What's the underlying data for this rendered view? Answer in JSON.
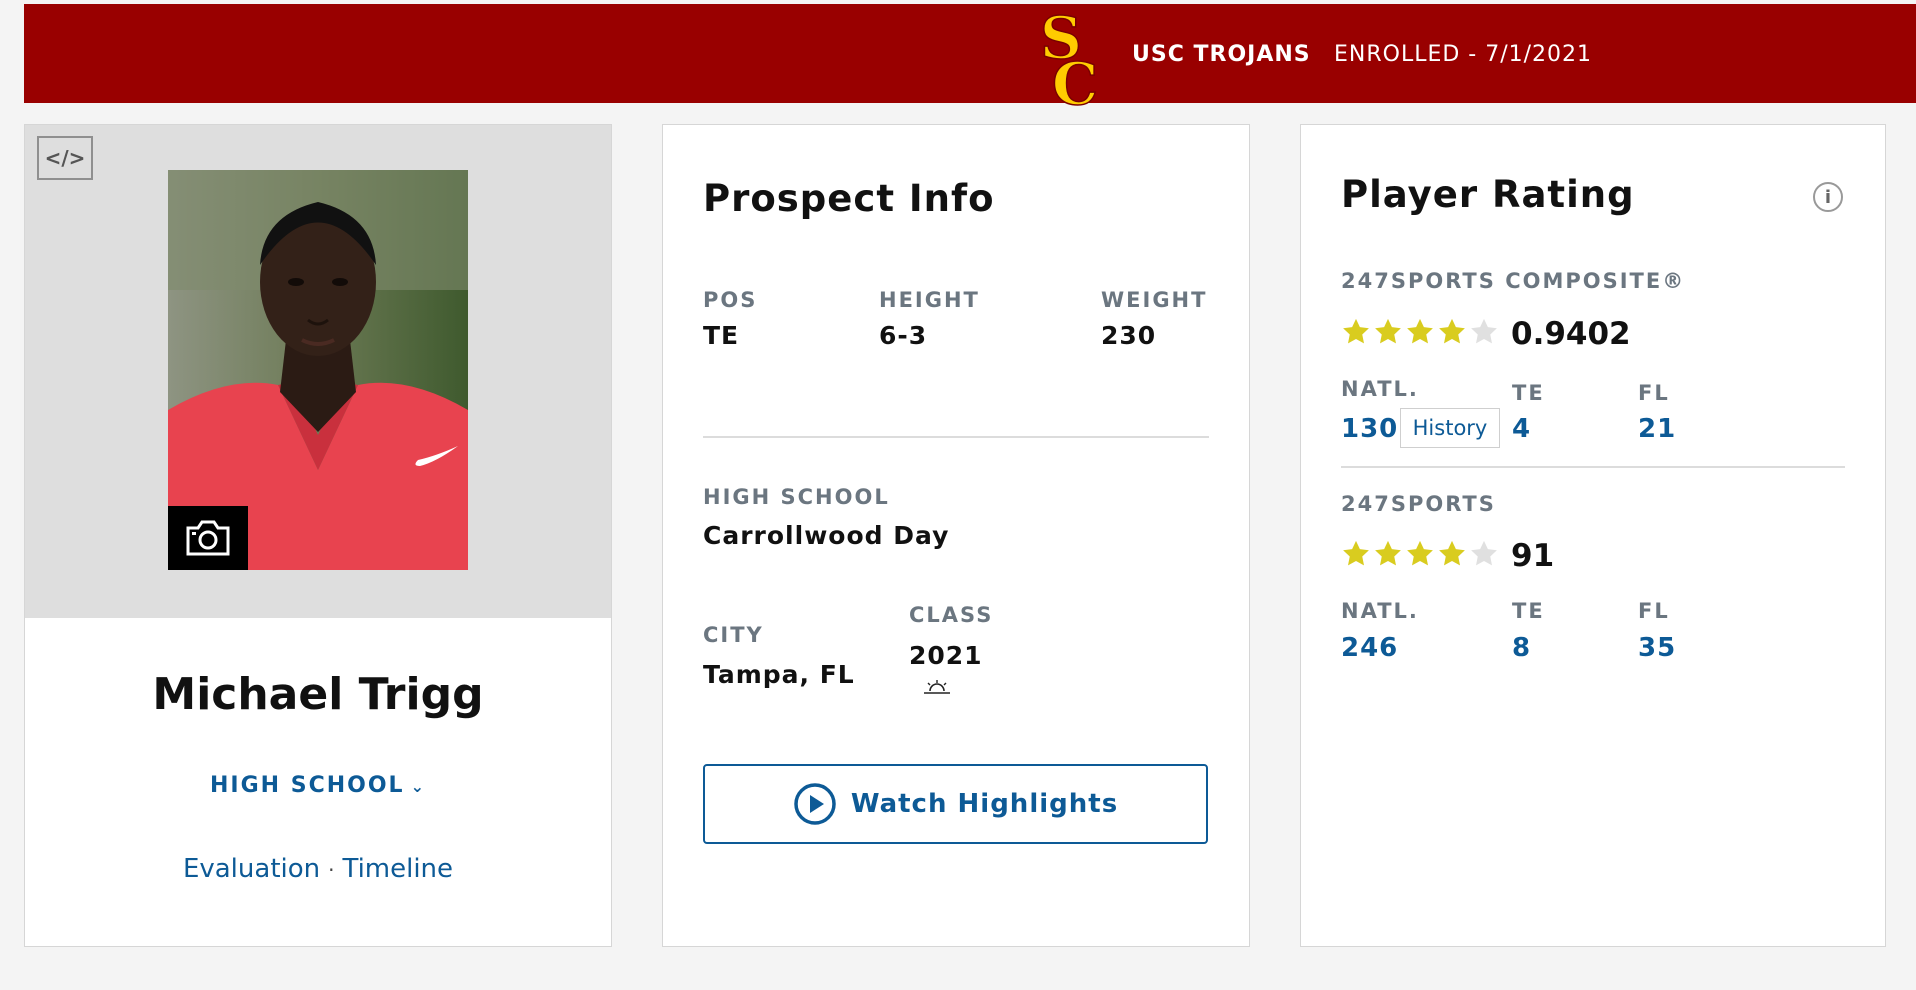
{
  "banner": {
    "team": "USC TROJANS",
    "status": "ENROLLED - 7/1/2021",
    "logo_text": "SC",
    "bg_color": "#990000",
    "logo_color": "#ffcc00"
  },
  "profile": {
    "embed_icon": "</>",
    "camera_icon": "camera-icon",
    "name": "Michael Trigg",
    "high_school_link": "HIGH SCHOOL",
    "links": {
      "evaluation": "Evaluation",
      "separator": "·",
      "timeline": "Timeline"
    }
  },
  "prospect": {
    "title": "Prospect Info",
    "pos_label": "POS",
    "pos_value": "TE",
    "height_label": "HEIGHT",
    "height_value": "6-3",
    "weight_label": "WEIGHT",
    "weight_value": "230",
    "hs_label": "HIGH SCHOOL",
    "hs_value": "Carrollwood Day",
    "city_label": "CITY",
    "city_value": "Tampa, FL",
    "class_label": "CLASS",
    "class_value": "2021",
    "watch_label": "Watch Highlights"
  },
  "rating": {
    "title": "Player Rating",
    "info_icon": "i",
    "composite": {
      "label": "247SPORTS COMPOSITE®",
      "stars": 4,
      "max_stars": 5,
      "score": "0.9402",
      "natl_label": "NATL.",
      "natl_value": "130",
      "history_label": "History",
      "pos_label": "TE",
      "pos_value": "4",
      "state_label": "FL",
      "state_value": "21"
    },
    "sports247": {
      "label": "247SPORTS",
      "stars": 4,
      "max_stars": 5,
      "score": "91",
      "natl_label": "NATL.",
      "natl_value": "246",
      "pos_label": "TE",
      "pos_value": "8",
      "state_label": "FL",
      "state_value": "35"
    },
    "star_color": "#d9cc1f",
    "star_empty_color": "#e0e0e0",
    "link_color": "#0d5a96"
  }
}
